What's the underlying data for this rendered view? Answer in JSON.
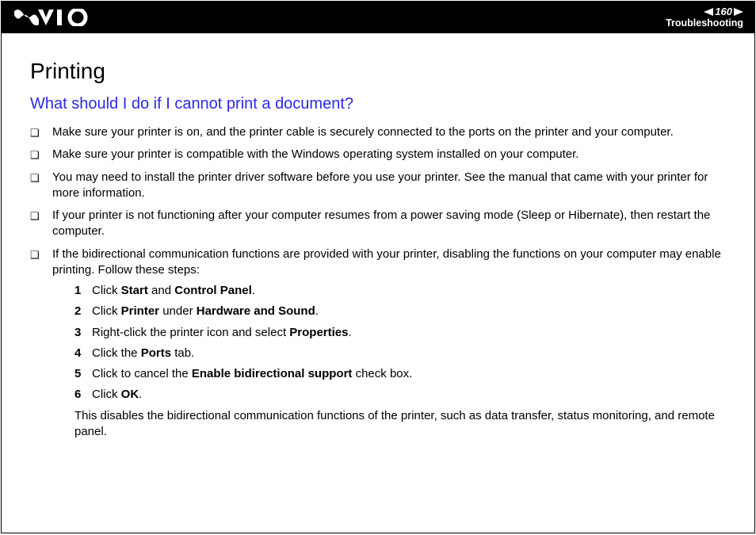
{
  "header": {
    "page_number": "160",
    "section": "Troubleshooting"
  },
  "content": {
    "h1": "Printing",
    "h2": "What should I do if I cannot print a document?",
    "bullets": [
      {
        "html": "Make sure your printer is on, and the printer cable is securely connected to the ports on the printer and your computer."
      },
      {
        "html": "Make sure your printer is compatible with the Windows operating system installed on your computer."
      },
      {
        "html": "You may need to install the printer driver software before you use your printer. See the manual that came with your printer for more information."
      },
      {
        "html": "If your printer is not functioning after your computer resumes from a power saving mode (Sleep or Hibernate), then restart the computer."
      },
      {
        "html": "If the bidirectional communication functions are provided with your printer, disabling the functions on your computer may enable printing. Follow these steps:"
      }
    ],
    "steps": [
      {
        "n": "1",
        "html": "Click <b>Start</b> and <b>Control Panel</b>."
      },
      {
        "n": "2",
        "html": "Click <b>Printer</b> under <b>Hardware and Sound</b>."
      },
      {
        "n": "3",
        "html": "Right-click the printer icon and select <b>Properties</b>."
      },
      {
        "n": "4",
        "html": "Click the <b>Ports</b> tab."
      },
      {
        "n": "5",
        "html": "Click to cancel the <b>Enable bidirectional support</b> check box."
      },
      {
        "n": "6",
        "html": "Click <b>OK</b>."
      }
    ],
    "trailing": "This disables the bidirectional communication functions of the printer, such as data transfer, status monitoring, and remote panel."
  }
}
